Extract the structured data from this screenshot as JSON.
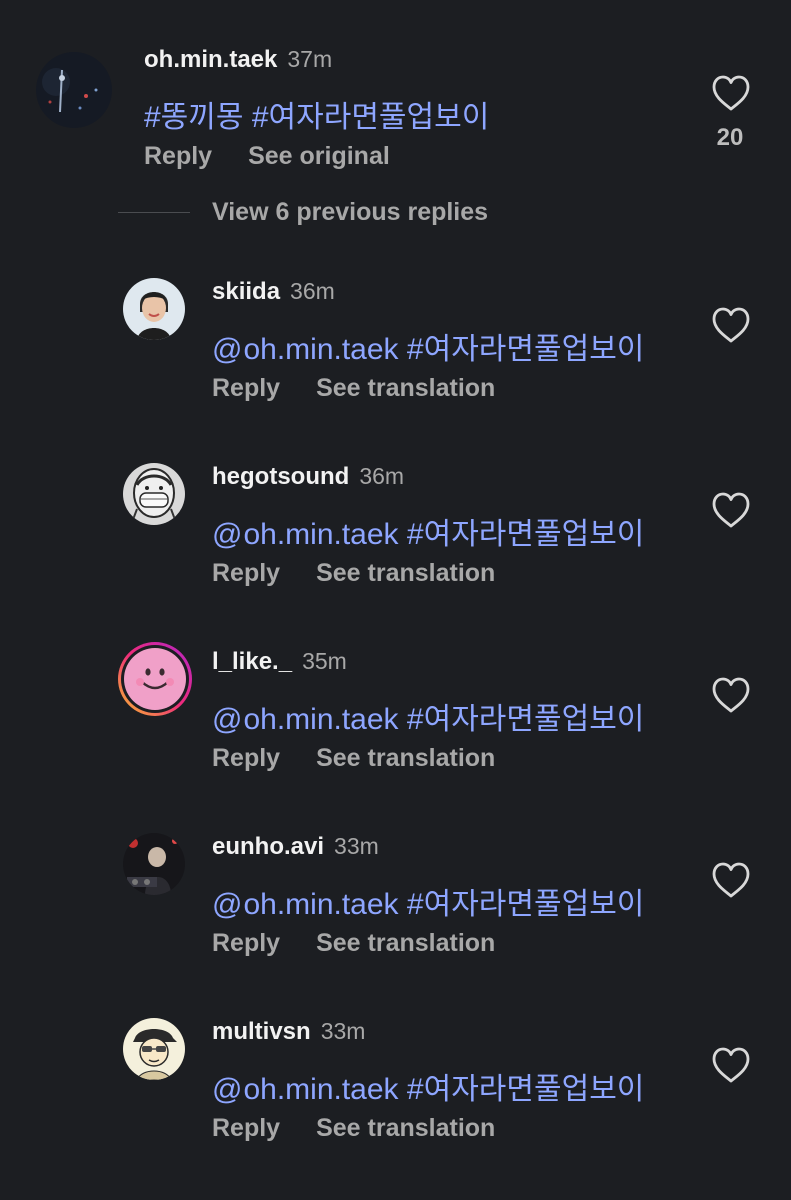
{
  "top_comment": {
    "username": "oh.min.taek",
    "time": "37m",
    "text_parts": [
      "#똥끼몽",
      "#여자라면풀업보이"
    ],
    "actions": {
      "reply": "Reply",
      "see": "See original"
    },
    "likes": "20",
    "like_icon": "heart-outline-icon",
    "avatar_icon": "dark-photo-avatar"
  },
  "view_replies_label": "View 6 previous replies",
  "replies": [
    {
      "username": "skiida",
      "time": "36m",
      "mention_glyph": "@",
      "mention": "oh.min.taek",
      "hashtag": "#여자라면풀업보이",
      "actions": {
        "reply": "Reply",
        "see": "See translation"
      }
    },
    {
      "username": "hegotsound",
      "time": "36m",
      "mention_glyph": "@",
      "mention": "oh.min.taek",
      "hashtag": "#여자라면풀업보이",
      "actions": {
        "reply": "Reply",
        "see": "See translation"
      }
    },
    {
      "username": "l_like._",
      "time": "35m",
      "mention_glyph": "@",
      "mention": "oh.min.taek",
      "hashtag": "#여자라면풀업보이",
      "actions": {
        "reply": "Reply",
        "see": "See translation"
      }
    },
    {
      "username": "eunho.avi",
      "time": "33m",
      "mention_glyph": "@",
      "mention": "oh.min.taek",
      "hashtag": "#여자라면풀업보이",
      "actions": {
        "reply": "Reply",
        "see": "See translation"
      }
    },
    {
      "username": "multivsn",
      "time": "33m",
      "mention_glyph": "@",
      "mention": "oh.min.taek",
      "hashtag": "#여자라면풀업보이",
      "actions": {
        "reply": "Reply",
        "see": "See translation"
      }
    }
  ],
  "colors": {
    "background": "#1c1e22",
    "link": "#8ea6ff",
    "muted": "#a8a8a8",
    "story_ring_start": "#f9c02e",
    "story_ring_end": "#d6249f"
  }
}
